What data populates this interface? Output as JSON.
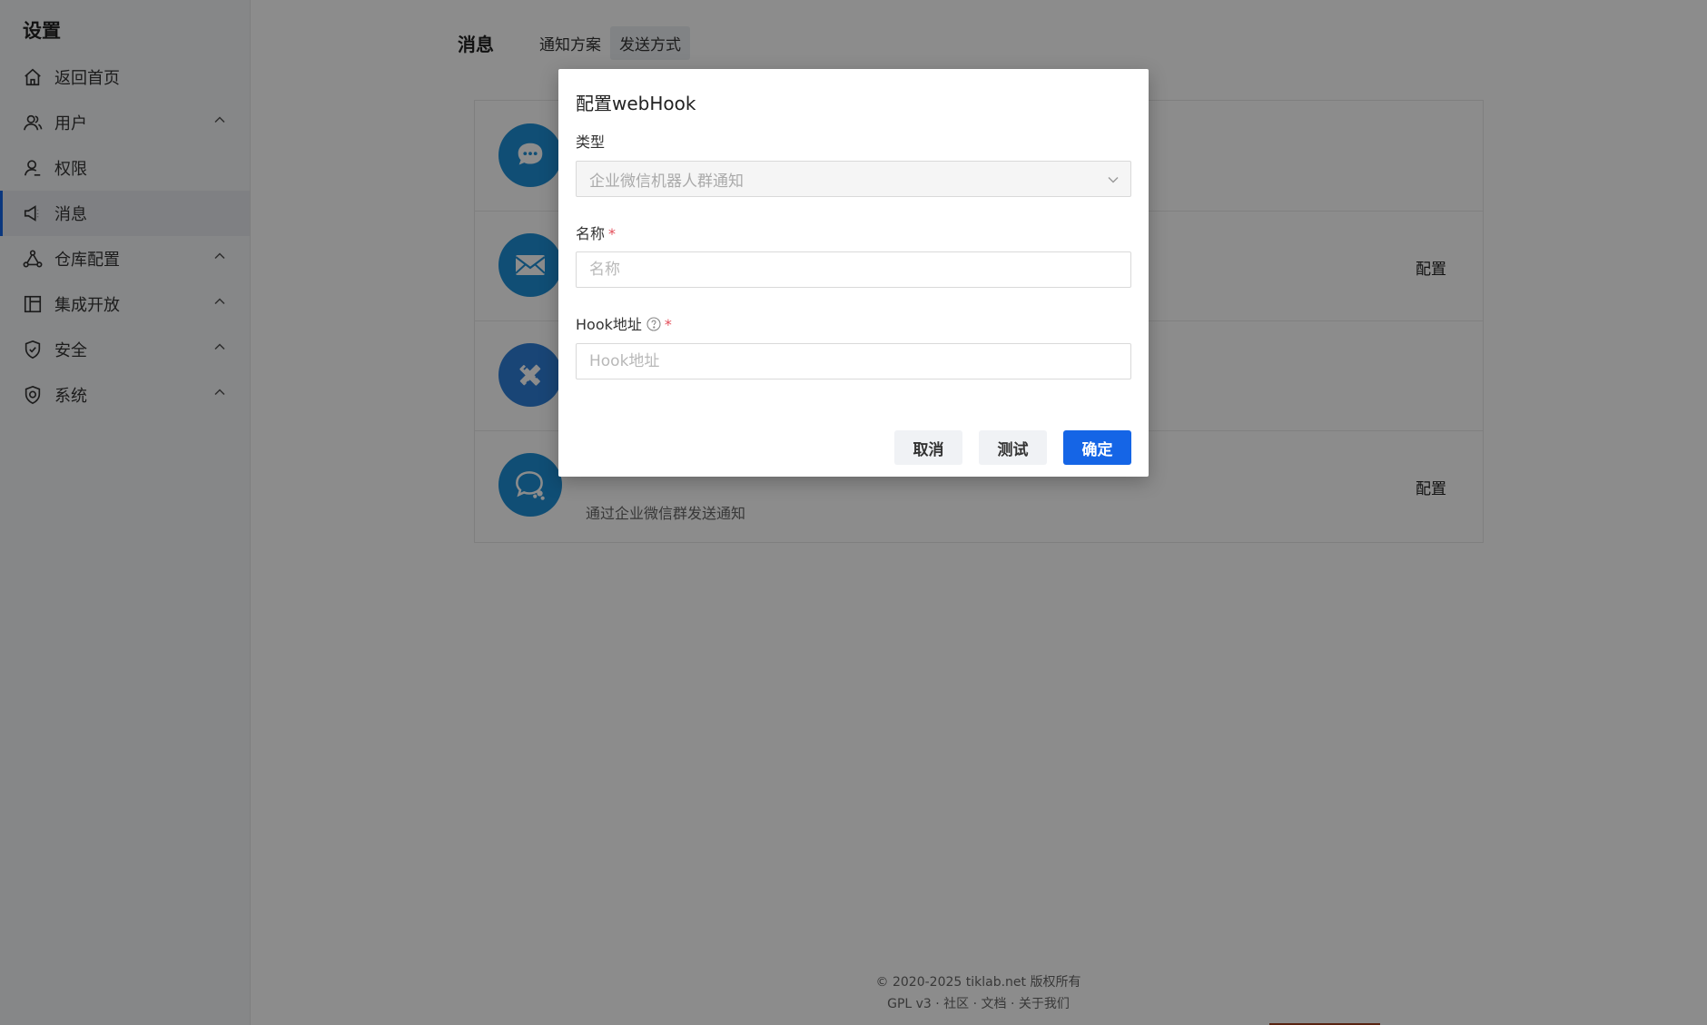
{
  "sidebar": {
    "title": "设置",
    "items": [
      {
        "label": "返回首页",
        "icon": "home-icon",
        "expandable": false
      },
      {
        "label": "用户",
        "icon": "users-icon",
        "expandable": true
      },
      {
        "label": "权限",
        "icon": "user-icon",
        "expandable": false
      },
      {
        "label": "消息",
        "icon": "megaphone-icon",
        "expandable": false,
        "active": true
      },
      {
        "label": "仓库配置",
        "icon": "network-icon",
        "expandable": true
      },
      {
        "label": "集成开放",
        "icon": "layout-icon",
        "expandable": true
      },
      {
        "label": "安全",
        "icon": "shield-check-icon",
        "expandable": true
      },
      {
        "label": "系统",
        "icon": "shield-badge-icon",
        "expandable": true
      }
    ]
  },
  "header": {
    "title": "消息",
    "tabs": [
      {
        "label": "通知方案",
        "active": false
      },
      {
        "label": "发送方式",
        "active": true
      }
    ]
  },
  "methods": [
    {
      "icon": "chat-bubble-icon",
      "color": "#1e8fd6",
      "config_label": "",
      "desc": ""
    },
    {
      "icon": "mail-icon",
      "color": "#1e8fd6",
      "config_label": "配置",
      "desc": ""
    },
    {
      "icon": "pencil-ruler-icon",
      "color": "#2f7fd8",
      "config_label": "",
      "desc": ""
    },
    {
      "icon": "wechat-work-icon",
      "color": "#1e8fd6",
      "config_label": "配置",
      "desc": "通过企业微信群发送通知"
    }
  ],
  "footer": {
    "line1": "© 2020-2025 tiklab.net 版权所有",
    "line2": "GPL v3 · 社区 · 文档 · 关于我们"
  },
  "modal": {
    "title": "配置webHook",
    "type_label": "类型",
    "type_value": "企业微信机器人群通知",
    "name_label": "名称",
    "name_placeholder": "名称",
    "hook_label": "Hook地址",
    "hook_placeholder": "Hook地址",
    "required_mark": "*",
    "cancel_label": "取消",
    "test_label": "测试",
    "confirm_label": "确定"
  },
  "colors": {
    "primary": "#1565e6",
    "required": "#e34d59"
  }
}
